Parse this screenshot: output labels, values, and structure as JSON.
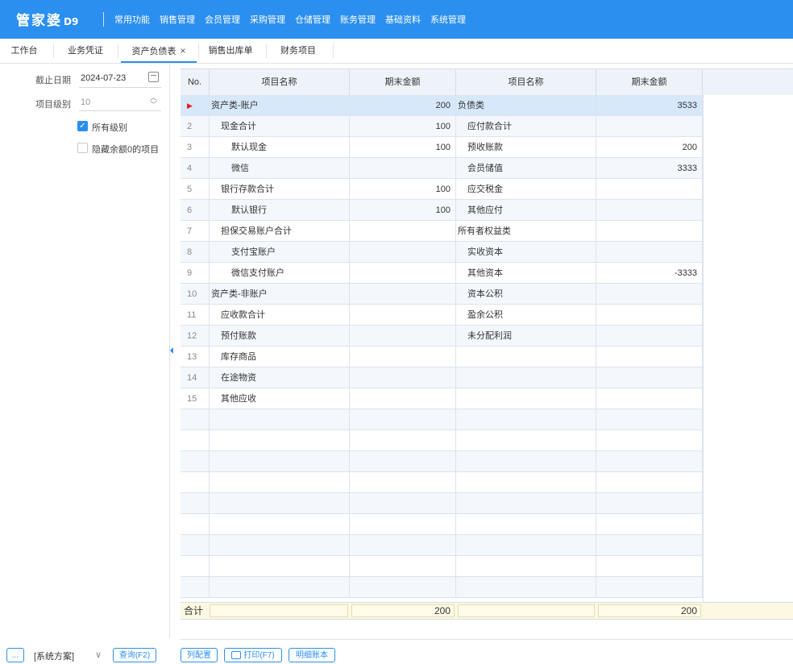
{
  "app": {
    "logo": "管家婆",
    "logo_sup": "D9"
  },
  "menu": [
    "常用功能",
    "销售管理",
    "会员管理",
    "采购管理",
    "仓储管理",
    "账务管理",
    "基础资料",
    "系统管理"
  ],
  "tabs": [
    {
      "label": "工作台",
      "active": false
    },
    {
      "label": "业务凭证",
      "active": false
    },
    {
      "label": "资产负债表",
      "active": true,
      "closable": true,
      "close": "×"
    },
    {
      "label": "销售出库单",
      "active": false
    },
    {
      "label": "财务项目",
      "active": false
    }
  ],
  "filters": {
    "end_date_label": "截止日期",
    "end_date_value": "2024-07-23",
    "level_label": "项目级别",
    "level_value": "10",
    "all_levels_label": "所有级别",
    "all_levels_checked": true,
    "hide_zero_label": "隐藏余额0的项目",
    "hide_zero_checked": false
  },
  "grid": {
    "headers": [
      "No.",
      "项目名称",
      "期末金额",
      "项目名称",
      "期末金额"
    ],
    "rows": [
      {
        "no": "",
        "n1": "资产类-账户",
        "l1": 0,
        "a1": "200",
        "n2": "负债类",
        "l2": 0,
        "a2": "3533",
        "selected": true
      },
      {
        "no": "2",
        "n1": "现金合计",
        "l1": 1,
        "a1": "100",
        "n2": "应付款合计",
        "l2": 1,
        "a2": ""
      },
      {
        "no": "3",
        "n1": "默认现金",
        "l1": 2,
        "a1": "100",
        "n2": "预收账款",
        "l2": 1,
        "a2": "200"
      },
      {
        "no": "4",
        "n1": "微信",
        "l1": 2,
        "a1": "",
        "n2": "会员储值",
        "l2": 1,
        "a2": "3333"
      },
      {
        "no": "5",
        "n1": "银行存款合计",
        "l1": 1,
        "a1": "100",
        "n2": "应交税金",
        "l2": 1,
        "a2": ""
      },
      {
        "no": "6",
        "n1": "默认银行",
        "l1": 2,
        "a1": "100",
        "n2": "其他应付",
        "l2": 1,
        "a2": ""
      },
      {
        "no": "7",
        "n1": "担保交易账户合计",
        "l1": 1,
        "a1": "",
        "n2": "所有者权益类",
        "l2": 0,
        "a2": ""
      },
      {
        "no": "8",
        "n1": "支付宝账户",
        "l1": 2,
        "a1": "",
        "n2": "实收资本",
        "l2": 1,
        "a2": ""
      },
      {
        "no": "9",
        "n1": "微信支付账户",
        "l1": 2,
        "a1": "",
        "n2": "其他资本",
        "l2": 1,
        "a2": "-3333"
      },
      {
        "no": "10",
        "n1": "资产类-非账户",
        "l1": 0,
        "a1": "",
        "n2": "资本公积",
        "l2": 1,
        "a2": ""
      },
      {
        "no": "11",
        "n1": "应收款合计",
        "l1": 1,
        "a1": "",
        "n2": "盈余公积",
        "l2": 1,
        "a2": ""
      },
      {
        "no": "12",
        "n1": "预付账款",
        "l1": 1,
        "a1": "",
        "n2": "未分配利润",
        "l2": 1,
        "a2": ""
      },
      {
        "no": "13",
        "n1": "库存商品",
        "l1": 1,
        "a1": "",
        "n2": "",
        "l2": 1,
        "a2": ""
      },
      {
        "no": "14",
        "n1": "在途物资",
        "l1": 1,
        "a1": "",
        "n2": "",
        "l2": 1,
        "a2": ""
      },
      {
        "no": "15",
        "n1": "其他应收",
        "l1": 1,
        "a1": "",
        "n2": "",
        "l2": 1,
        "a2": ""
      },
      {
        "no": "",
        "n1": "",
        "l1": 0,
        "a1": "",
        "n2": "",
        "l2": 0,
        "a2": ""
      },
      {
        "no": "",
        "n1": "",
        "l1": 0,
        "a1": "",
        "n2": "",
        "l2": 0,
        "a2": ""
      },
      {
        "no": "",
        "n1": "",
        "l1": 0,
        "a1": "",
        "n2": "",
        "l2": 0,
        "a2": ""
      },
      {
        "no": "",
        "n1": "",
        "l1": 0,
        "a1": "",
        "n2": "",
        "l2": 0,
        "a2": ""
      },
      {
        "no": "",
        "n1": "",
        "l1": 0,
        "a1": "",
        "n2": "",
        "l2": 0,
        "a2": ""
      },
      {
        "no": "",
        "n1": "",
        "l1": 0,
        "a1": "",
        "n2": "",
        "l2": 0,
        "a2": ""
      },
      {
        "no": "",
        "n1": "",
        "l1": 0,
        "a1": "",
        "n2": "",
        "l2": 0,
        "a2": ""
      },
      {
        "no": "",
        "n1": "",
        "l1": 0,
        "a1": "",
        "n2": "",
        "l2": 0,
        "a2": ""
      },
      {
        "no": "",
        "n1": "",
        "l1": 0,
        "a1": "",
        "n2": "",
        "l2": 0,
        "a2": ""
      }
    ],
    "footer": {
      "label": "合计",
      "a1": "200",
      "a2": "200"
    }
  },
  "bottom": {
    "more_label": "...",
    "scheme_label": "[系统方案]",
    "scheme_arrow": "∨",
    "query_label": "查询(F2)",
    "columns_label": "列配置",
    "print_label": "打印(F7)",
    "detail_label": "明细账本"
  },
  "colors": {
    "accent": "#2b8ff0",
    "selected_row": "#d7e8fb",
    "footer_bg": "#fdf8e1"
  }
}
